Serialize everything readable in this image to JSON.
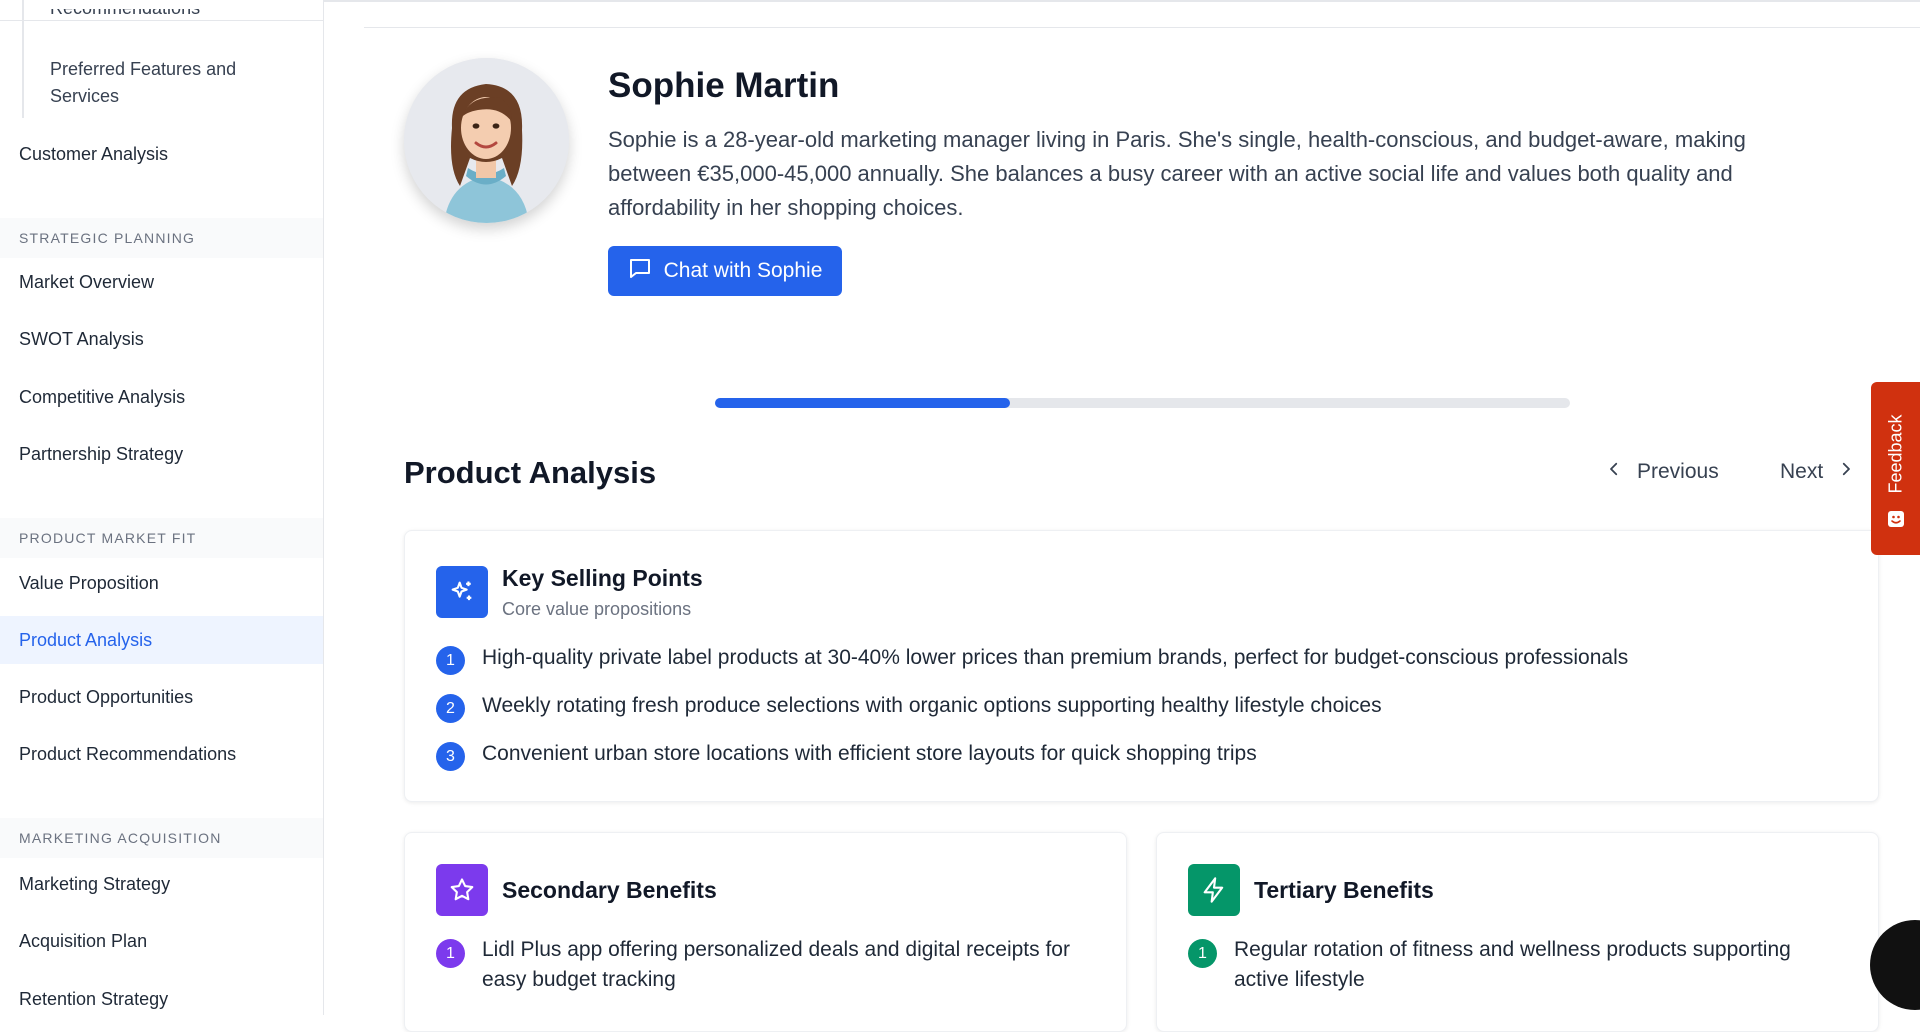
{
  "sidebar": {
    "top_sub_items": [
      "Recommendations",
      "Preferred Features and Services"
    ],
    "customer_analysis": "Customer Analysis",
    "sections": [
      {
        "title": "Strategic Planning",
        "items": [
          "Market Overview",
          "SWOT Analysis",
          "Competitive Analysis",
          "Partnership Strategy"
        ]
      },
      {
        "title": "Product Market Fit",
        "items": [
          "Value Proposition",
          "Product Analysis",
          "Product Opportunities",
          "Product Recommendations"
        ]
      },
      {
        "title": "Marketing Acquisition",
        "items": [
          "Marketing Strategy",
          "Acquisition Plan",
          "Retention Strategy"
        ]
      }
    ],
    "active_item": "Product Analysis"
  },
  "profile": {
    "name": "Sophie Martin",
    "bio": "Sophie is a 28-year-old marketing manager living in Paris. She's single, health-conscious, and budget-aware, making between €35,000-45,000 annually. She balances a busy career with an active social life and values both quality and affordability in her shopping choices.",
    "chat_button": "Chat with Sophie"
  },
  "progress": {
    "value": 0.345
  },
  "section": {
    "title": "Product Analysis",
    "prev_label": "Previous",
    "next_label": "Next"
  },
  "key_selling": {
    "title": "Key Selling Points",
    "subtitle": "Core value propositions",
    "items": [
      "High-quality private label products at 30-40% lower prices than premium brands, perfect for budget-conscious professionals",
      "Weekly rotating fresh produce selections with organic options supporting healthy lifestyle choices",
      "Convenient urban store locations with efficient store layouts for quick shopping trips"
    ]
  },
  "secondary": {
    "title": "Secondary Benefits",
    "items": [
      "Lidl Plus app offering personalized deals and digital receipts for easy budget tracking"
    ]
  },
  "tertiary": {
    "title": "Tertiary Benefits",
    "items": [
      "Regular rotation of fitness and wellness products supporting active lifestyle"
    ]
  },
  "feedback": {
    "label": "Feedback"
  },
  "colors": {
    "accent": "#2563eb",
    "purple": "#7c3aed",
    "green": "#059669",
    "feedback": "#d0310f"
  }
}
